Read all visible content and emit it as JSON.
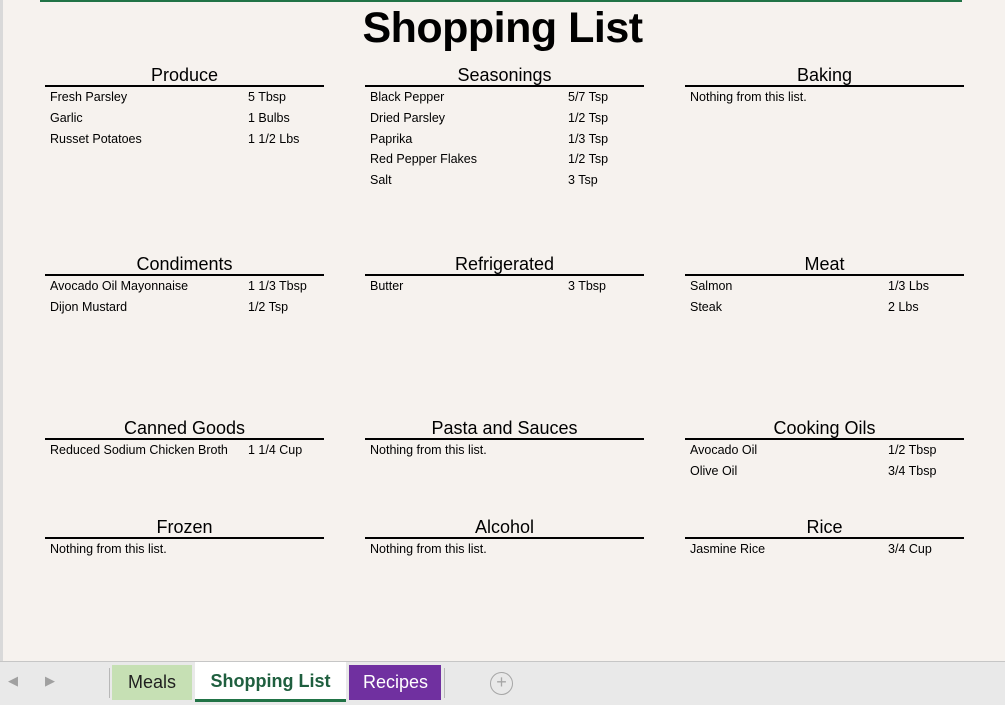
{
  "title": "Shopping List",
  "empty_text": "Nothing from this list.",
  "sections": [
    {
      "name": "Produce",
      "items": [
        {
          "name": "Fresh Parsley",
          "qty": "5 Tbsp"
        },
        {
          "name": "Garlic",
          "qty": "1 Bulbs"
        },
        {
          "name": "Russet Potatoes",
          "qty": "1 1/2 Lbs"
        }
      ]
    },
    {
      "name": "Seasonings",
      "items": [
        {
          "name": "Black Pepper",
          "qty": "5/7 Tsp"
        },
        {
          "name": "Dried Parsley",
          "qty": "1/2 Tsp"
        },
        {
          "name": "Paprika",
          "qty": "1/3 Tsp"
        },
        {
          "name": "Red Pepper Flakes",
          "qty": "1/2 Tsp"
        },
        {
          "name": "Salt",
          "qty": "3 Tsp"
        }
      ]
    },
    {
      "name": "Baking",
      "items": []
    },
    {
      "name": "Condiments",
      "items": [
        {
          "name": "Avocado Oil Mayonnaise",
          "qty": "1 1/3 Tbsp"
        },
        {
          "name": "Dijon Mustard",
          "qty": "1/2 Tsp"
        }
      ]
    },
    {
      "name": "Refrigerated",
      "items": [
        {
          "name": "Butter",
          "qty": "3 Tbsp"
        }
      ]
    },
    {
      "name": "Meat",
      "items": [
        {
          "name": "Salmon",
          "qty": "1/3 Lbs"
        },
        {
          "name": "Steak",
          "qty": "2 Lbs"
        }
      ]
    },
    {
      "name": "Canned Goods",
      "items": [
        {
          "name": "Reduced Sodium Chicken Broth",
          "qty": "1 1/4 Cup"
        }
      ]
    },
    {
      "name": "Pasta and Sauces",
      "items": []
    },
    {
      "name": "Cooking Oils",
      "items": [
        {
          "name": "Avocado Oil",
          "qty": "1/2 Tbsp"
        },
        {
          "name": "Olive Oil",
          "qty": "3/4 Tbsp"
        }
      ]
    },
    {
      "name": "Frozen",
      "items": []
    },
    {
      "name": "Alcohol",
      "items": []
    },
    {
      "name": "Rice",
      "items": [
        {
          "name": "Jasmine Rice",
          "qty": "3/4 Cup"
        }
      ]
    }
  ],
  "sheet_tabs": [
    {
      "label": "Meals",
      "color": "#c6e0b4",
      "active": false
    },
    {
      "label": "Shopping List",
      "color": "#ffffff",
      "active": true
    },
    {
      "label": "Recipes",
      "color": "#7030a0",
      "active": false
    }
  ],
  "icons": {
    "prev_sheet": "chevron-left-icon",
    "next_sheet": "chevron-right-icon",
    "add_sheet": "plus-circle-icon"
  }
}
